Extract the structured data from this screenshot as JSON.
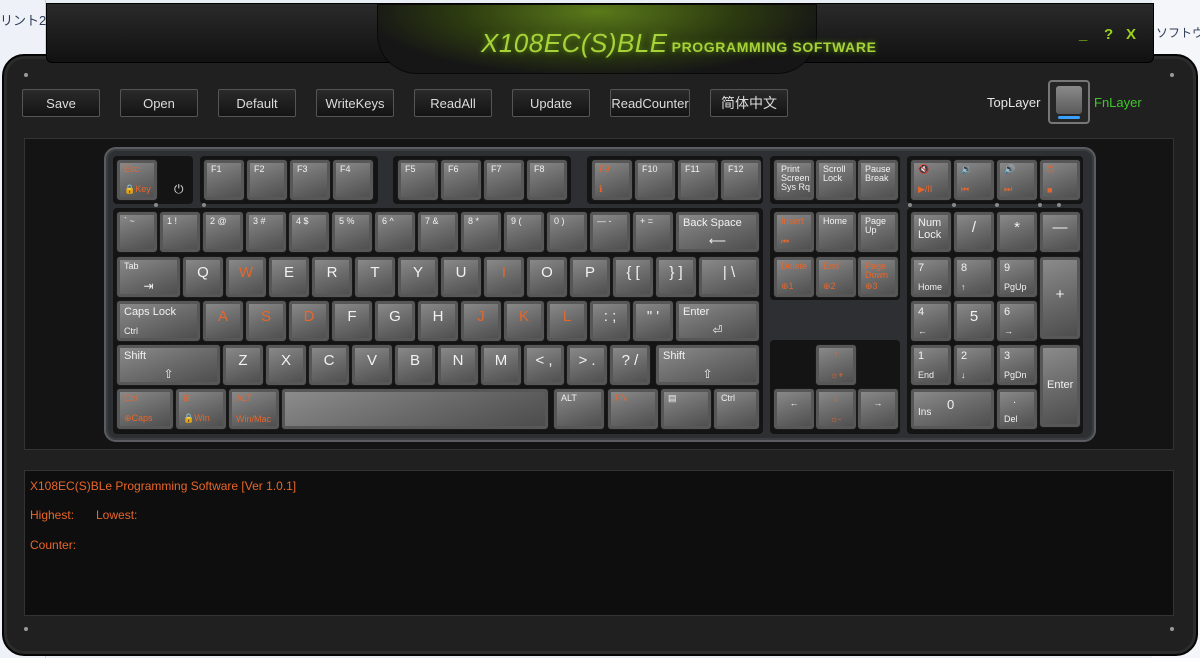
{
  "desktop": {
    "left_text": "リント2.0",
    "right_text": "ソフトウェ"
  },
  "window": {
    "title": "X108EC(S)BLE",
    "subtitle": "PROGRAMMING SOFTWARE",
    "min": "_",
    "help": "?",
    "close": "X"
  },
  "toolbar": {
    "save": "Save",
    "open": "Open",
    "default": "Default",
    "writekeys": "WriteKeys",
    "readall": "ReadAll",
    "update": "Update",
    "readcounter": "ReadCounter",
    "chinese": "简体中文"
  },
  "layer": {
    "top": "TopLayer",
    "fn": "FnLayer"
  },
  "console": {
    "version": "X108EC(S)BLe Programming Software [Ver 1.0.1]",
    "highest": "Highest:",
    "lowest": "Lowest:",
    "counter": "Counter:"
  },
  "keys": {
    "esc": "Esc",
    "esc_sub": "🔒Key",
    "f1": "F1",
    "f2": "F2",
    "f3": "F3",
    "f4": "F4",
    "f5": "F5",
    "f6": "F6",
    "f7": "F7",
    "f8": "F8",
    "f9": "F9",
    "f9_sub": "ℹ",
    "f10": "F10",
    "f11": "F11",
    "f12": "F12",
    "prtsc": "Print\nScreen\nSys Rq",
    "scroll": "Scroll\nLock",
    "pause": "Pause\nBreak",
    "m1": "🔇",
    "m1b": "▶/II",
    "m2": "🔉",
    "m2b": "⏮",
    "m3": "🔊",
    "m3b": "⏭",
    "m4": "⏻",
    "m4b": "■",
    "grave": "` ~",
    "n1": "1 !",
    "n2": "2 @",
    "n3": "3 #",
    "n4": "4 $",
    "n5": "5 %",
    "n6": "6 ^",
    "n7": "7 &",
    "n8": "8 *",
    "n9": "9 (",
    "n0": "0 )",
    "minus": "— -",
    "equal": "+ =",
    "bksp": "Back Space",
    "ins": "Insert",
    "ins_sub": "⏮",
    "home": "Home",
    "pgup": "Page\nUp",
    "numlock": "Num\nLock",
    "slash": "/",
    "star": "*",
    "nminus": "—",
    "tab": "Tab",
    "q": "Q",
    "w": "W",
    "e": "E",
    "r": "R",
    "t": "T",
    "y": "Y",
    "u": "U",
    "i": "I",
    "o": "O",
    "p": "P",
    "lbr": "{ [",
    "rbr": "} ]",
    "bsl": "| \\",
    "del": "Delete",
    "del_sub": "⊕1",
    "end": "End",
    "end_sub": "⊕2",
    "pgdn": "Page\nDown",
    "pgdn_sub": "⊕3",
    "n7k": "7",
    "n7s": "Home",
    "n8k": "8",
    "n8s": "↑",
    "n9k": "9",
    "n9s": "PgUp",
    "nplus": "+",
    "caps": "Caps Lock",
    "caps_sub": "Ctrl",
    "a": "A",
    "s": "S",
    "d": "D",
    "f": "F",
    "g": "G",
    "h": "H",
    "j": "J",
    "k": "K",
    "l": "L",
    "semi": ": ;",
    "quote": "\" '",
    "enter": "Enter",
    "n4k": "4",
    "n4s": "←",
    "n5k": "5",
    "n6k": "6",
    "n6s": "→",
    "lshift": "Shift",
    "z": "Z",
    "x": "X",
    "c": "C",
    "v": "V",
    "b": "B",
    "n": "N",
    "m": "M",
    "comma": "< ,",
    "period": "> .",
    "qm": "? /",
    "rshift": "Shift",
    "up": "↑",
    "up_sub": "☼+",
    "n1k": "1",
    "n1s": "End",
    "n2k": "2",
    "n2s": "↓",
    "n3k": "3",
    "n3s": "PgDn",
    "nenter": "Enter",
    "lctrl": "Ctrl",
    "lctrl_sub": "⊕Caps",
    "win": "⊞",
    "win_sub": "🔒Win",
    "lalt": "ALT",
    "lalt_sub": "Win/Mac",
    "ralt": "ALT",
    "fn": "FN",
    "menu": "▤",
    "rctrl": "Ctrl",
    "left": "←",
    "down": "↓",
    "down_sub": "☼-",
    "right": "→",
    "n0k": "Ins",
    "n0c": "0",
    "ndot": ".",
    "ndots": "Del"
  },
  "colors": {
    "accent_green": "#9ad21c",
    "orange": "#e8662a",
    "fn_green": "#3ec82a"
  }
}
